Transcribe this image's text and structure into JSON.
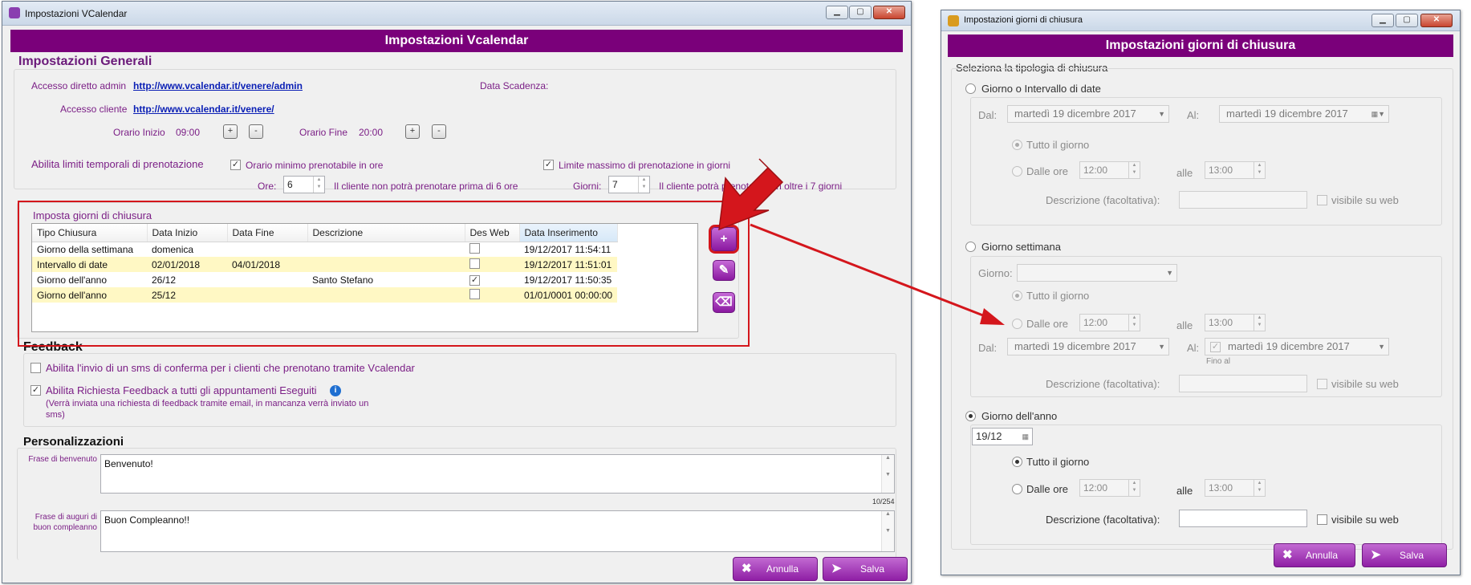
{
  "main_window": {
    "title": "Impostazioni VCalendar",
    "banner": "Impostazioni Vcalendar",
    "controls": {
      "minimize": "▁",
      "maximize": "▢",
      "close": "✕"
    },
    "general": {
      "heading": "Impostazioni Generali",
      "admin_label": "Accesso diretto admin",
      "admin_url": "http://www.vcalendar.it/venere/admin",
      "expiry_label": "Data Scadenza:",
      "client_label": "Accesso cliente",
      "client_url": "http://www.vcalendar.it/venere/",
      "start_label": "Orario Inizio",
      "start_value": "09:00",
      "end_label": "Orario Fine",
      "end_value": "20:00",
      "plus": "+",
      "minus": "-",
      "limits_label": "Abilita limiti temporali di prenotazione",
      "min_label": "Orario minimo prenotabile in ore",
      "min_checked": "✓",
      "hours_label": "Ore:",
      "hours_value": "6",
      "hours_note": "Il cliente non potrà prenotare prima di 6 ore",
      "max_label": "Limite massimo di prenotazione in giorni",
      "max_checked": "✓",
      "days_label": "Giorni:",
      "days_value": "7",
      "days_note": "Il cliente potrà prenotare non oltre i 7 giorni"
    },
    "closure": {
      "heading": "Imposta giorni di chiusura",
      "columns": [
        "Tipo Chiusura",
        "Data Inizio",
        "Data Fine",
        "Descrizione",
        "Des Web",
        "Data Inserimento"
      ],
      "rows": [
        {
          "tipo": "Giorno della settimana",
          "inizio": "domenica",
          "fine": "",
          "descrizione": "",
          "web": "",
          "inserimento": "19/12/2017 11:54:11"
        },
        {
          "tipo": "Intervallo di date",
          "inizio": "02/01/2018",
          "fine": "04/01/2018",
          "descrizione": "",
          "web": "",
          "inserimento": "19/12/2017 11:51:01"
        },
        {
          "tipo": "Giorno dell'anno",
          "inizio": "26/12",
          "fine": "",
          "descrizione": "Santo Stefano",
          "web": "✓",
          "inserimento": "19/12/2017 11:50:35"
        },
        {
          "tipo": "Giorno dell'anno",
          "inizio": "25/12",
          "fine": "",
          "descrizione": "",
          "web": "",
          "inserimento": "01/01/0001 00:00:00"
        }
      ],
      "add_icon": "+",
      "edit_icon": "✎",
      "delete_icon": "⌫"
    },
    "feedback": {
      "heading": "Feedback",
      "sms_label": "Abilita l'invio di un sms di conferma per i clienti che prenotano tramite Vcalendar",
      "request_label": "Abilita Richiesta Feedback a tutti gli appuntamenti Eseguiti",
      "request_checked": "✓",
      "info_icon": "i",
      "note": "(Verrà inviata una richiesta di feedback tramite email, in mancanza verrà inviato un sms)"
    },
    "personal": {
      "heading": "Personalizzazioni",
      "welcome_label": "Frase di benvenuto",
      "welcome_value": "Benvenuto!",
      "welcome_count": "10/254",
      "bday_label": "Frase di auguri di buon compleanno",
      "bday_value": "Buon Compleanno!!"
    },
    "cancel_label": "Annulla",
    "save_label": "Salva"
  },
  "dialog": {
    "title": "Impostazioni giorni di chiusura",
    "banner": "Impostazioni giorni di chiusura",
    "controls": {
      "minimize": "▁",
      "maximize": "▢",
      "close": "✕"
    },
    "type_label": "Seleziona la tipologia di chiusura",
    "option_interval": "Giorno o Intervallo di date",
    "dal": "Dal:",
    "al": "Al:",
    "date_value": "martedì   19 dicembre 2017",
    "all_day": "Tutto il giorno",
    "from_hours": "Dalle ore",
    "time_from": "12:00",
    "to_label": "alle",
    "time_to": "13:00",
    "desc_label": "Descrizione (facoltativa):",
    "visible_web": "visibile su web",
    "option_weekday": "Giorno settimana",
    "day_label": "Giorno:",
    "fino_al": "Fino al",
    "option_yearday": "Giorno dell'anno",
    "yearday_value": "19/12",
    "cancel_label": "Annulla",
    "save_label": "Salva",
    "check_mark": "✓"
  },
  "colors": {
    "accent": "#7a007a",
    "highlight": "#d4161c",
    "row_alt": "#fff8c4"
  }
}
